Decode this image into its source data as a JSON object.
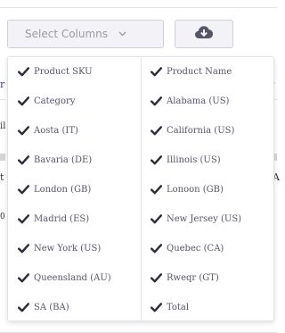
{
  "toolbar": {
    "select_columns_label": "Select Columns"
  },
  "background": {
    "fragment_1": "r",
    "fragment_2": "il",
    "fragment_3": "t",
    "fragment_4": "0",
    "fragment_right_1": "r",
    "fragment_right_2": "A"
  },
  "columns": {
    "left": [
      {
        "label": "Product SKU",
        "checked": true
      },
      {
        "label": "Category",
        "checked": true
      },
      {
        "label": "Aosta (IT)",
        "checked": true
      },
      {
        "label": "Bavaria (DE)",
        "checked": true
      },
      {
        "label": "London (GB)",
        "checked": true
      },
      {
        "label": "Madrid (ES)",
        "checked": true
      },
      {
        "label": "New York (US)",
        "checked": true
      },
      {
        "label": "Queensland (AU)",
        "checked": true
      },
      {
        "label": "SA (BA)",
        "checked": true
      }
    ],
    "right": [
      {
        "label": "Product Name",
        "checked": true
      },
      {
        "label": "Alabama (US)",
        "checked": true
      },
      {
        "label": "California (US)",
        "checked": true
      },
      {
        "label": "Illinois (US)",
        "checked": true
      },
      {
        "label": "Lonoon (GB)",
        "checked": true
      },
      {
        "label": "New Jersey (US)",
        "checked": true
      },
      {
        "label": "Quebec (CA)",
        "checked": true
      },
      {
        "label": "Rweqr (GT)",
        "checked": true
      },
      {
        "label": "Total",
        "checked": true
      }
    ]
  },
  "colors": {
    "check": "#2b2b3a",
    "label": "#55556a",
    "button_bg": "#f3f3f7",
    "icon": "#56566a"
  }
}
